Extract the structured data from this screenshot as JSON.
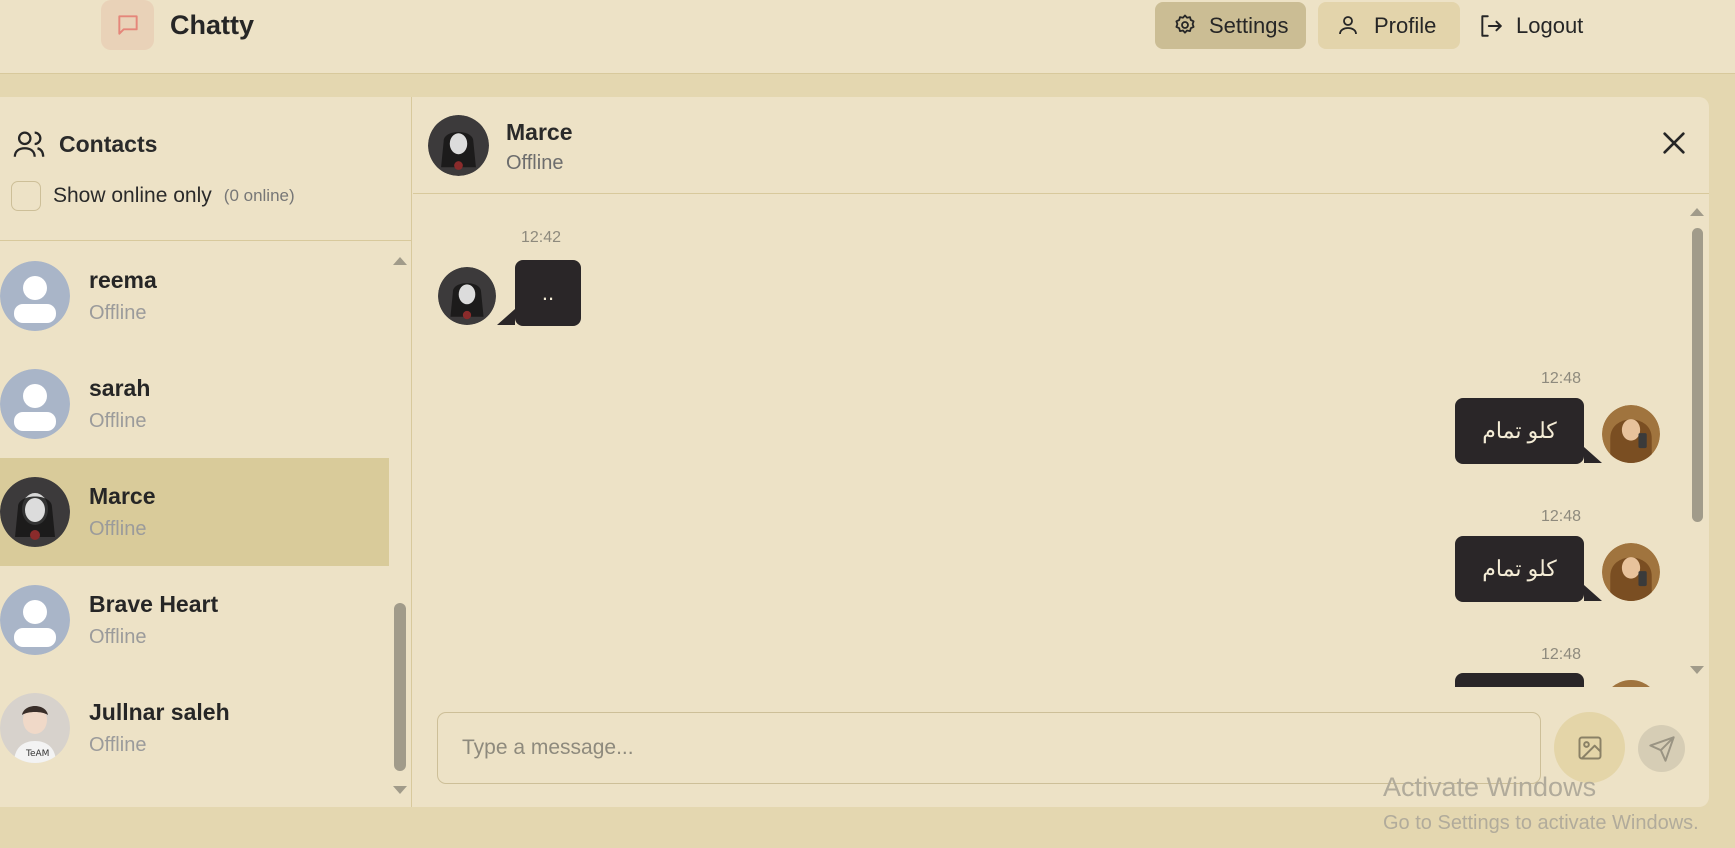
{
  "app": {
    "title": "Chatty"
  },
  "nav": {
    "settings": "Settings",
    "profile": "Profile",
    "logout": "Logout"
  },
  "sidebar": {
    "title": "Contacts",
    "online_filter_label": "Show online only",
    "online_count": "(0 online)",
    "contacts": [
      {
        "name": "reema",
        "status": "Offline",
        "avatar": "default-avatar"
      },
      {
        "name": "sarah",
        "status": "Offline",
        "avatar": "default-avatar"
      },
      {
        "name": "Marce",
        "status": "Offline",
        "avatar": "photo-avatar",
        "selected": true
      },
      {
        "name": "Brave Heart",
        "status": "Offline",
        "avatar": "default-avatar"
      },
      {
        "name": "Jullnar saleh",
        "status": "Offline",
        "avatar": "photo-avatar"
      }
    ]
  },
  "chat": {
    "name": "Marce",
    "status": "Offline",
    "messages": [
      {
        "time": "12:42",
        "text": "..",
        "side": "left"
      },
      {
        "time": "12:48",
        "text": "كلو تمام",
        "side": "right"
      },
      {
        "time": "12:48",
        "text": "كلو تمام",
        "side": "right"
      },
      {
        "time": "12:48",
        "text": "",
        "side": "right"
      }
    ],
    "composer_placeholder": "Type a message..."
  },
  "watermark": {
    "line1": "Activate Windows",
    "line2": "Go to Settings to activate Windows."
  },
  "colors": {
    "background": "#e4d7b0",
    "panel": "#ede2c6",
    "selected": "#d9cb9a",
    "bubble": "#2a2628",
    "logo_accent": "#e5867a"
  }
}
